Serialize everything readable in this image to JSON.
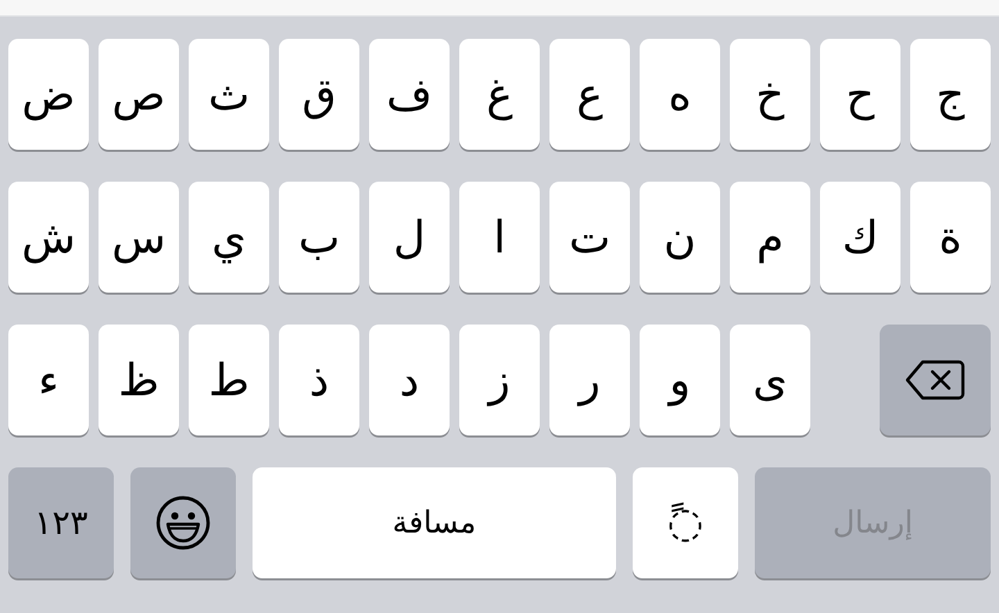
{
  "keyboard": {
    "rows": [
      {
        "keys": [
          {
            "kind": "letter",
            "label": "ج"
          },
          {
            "kind": "letter",
            "label": "ح"
          },
          {
            "kind": "letter",
            "label": "خ"
          },
          {
            "kind": "letter",
            "label": "ه"
          },
          {
            "kind": "letter",
            "label": "ع"
          },
          {
            "kind": "letter",
            "label": "غ"
          },
          {
            "kind": "letter",
            "label": "ف"
          },
          {
            "kind": "letter",
            "label": "ق"
          },
          {
            "kind": "letter",
            "label": "ث"
          },
          {
            "kind": "letter",
            "label": "ص"
          },
          {
            "kind": "letter",
            "label": "ض"
          }
        ]
      },
      {
        "keys": [
          {
            "kind": "letter",
            "label": "ة"
          },
          {
            "kind": "letter",
            "label": "ك"
          },
          {
            "kind": "letter",
            "label": "م"
          },
          {
            "kind": "letter",
            "label": "ن"
          },
          {
            "kind": "letter",
            "label": "ت"
          },
          {
            "kind": "letter",
            "label": "ا"
          },
          {
            "kind": "letter",
            "label": "ل"
          },
          {
            "kind": "letter",
            "label": "ب"
          },
          {
            "kind": "letter",
            "label": "ي"
          },
          {
            "kind": "letter",
            "label": "س"
          },
          {
            "kind": "letter",
            "label": "ش"
          }
        ]
      },
      {
        "keys": [
          {
            "kind": "backspace"
          },
          {
            "kind": "letter",
            "label": "ى"
          },
          {
            "kind": "letter",
            "label": "و"
          },
          {
            "kind": "letter",
            "label": "ر"
          },
          {
            "kind": "letter",
            "label": "ز"
          },
          {
            "kind": "letter",
            "label": "د"
          },
          {
            "kind": "letter",
            "label": "ذ"
          },
          {
            "kind": "letter",
            "label": "ط"
          },
          {
            "kind": "letter",
            "label": "ظ"
          },
          {
            "kind": "letter",
            "label": "ء"
          }
        ]
      }
    ],
    "bottom_row": [
      {
        "kind": "send",
        "label": "إرسال",
        "disabled": true
      },
      {
        "kind": "diacritic",
        "label": "◌ً"
      },
      {
        "kind": "space",
        "label": "مسافة"
      },
      {
        "kind": "emoji"
      },
      {
        "kind": "numbers",
        "label": "١٢٣"
      }
    ]
  }
}
